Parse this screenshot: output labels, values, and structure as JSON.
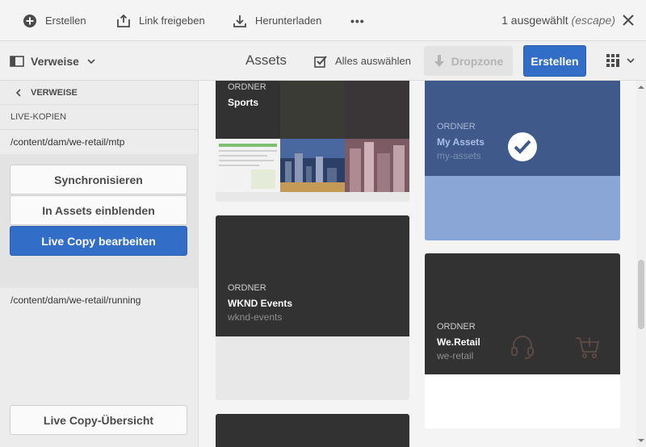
{
  "actionbar": {
    "create": "Erstellen",
    "share": "Link freigeben",
    "download": "Herunterladen",
    "more": "•••",
    "selection_count": "1 ausgewählt",
    "selection_hint": "(escape)"
  },
  "toolbar": {
    "rail_selector": "Verweise",
    "title": "Assets",
    "select_all": "Alles auswählen",
    "dropzone": "Dropzone",
    "create": "Erstellen"
  },
  "rail": {
    "back_label": "VERWEISE",
    "section_label": "LIVE-KOPIEN",
    "paths": [
      "/content/dam/we-retail/mtp",
      "/content/dam/we-retail/running"
    ],
    "buttons": {
      "sync": "Synchronisieren",
      "reveal": "In Assets einblenden",
      "edit": "Live Copy bearbeiten",
      "overview": "Live Copy-Übersicht"
    }
  },
  "cards": [
    {
      "kind": "ORDNER",
      "name": "Sports",
      "sub": ""
    },
    {
      "kind": "ORDNER",
      "name": "My Assets",
      "sub": "my-assets",
      "selected": true
    },
    {
      "kind": "ORDNER",
      "name": "WKND Events",
      "sub": "wknd-events"
    },
    {
      "kind": "ORDNER",
      "name": "We.Retail",
      "sub": "we-retail"
    }
  ],
  "colors": {
    "accent": "#326ec8",
    "selected_card": "#3f5a8a",
    "folder_dark": "#323232"
  }
}
